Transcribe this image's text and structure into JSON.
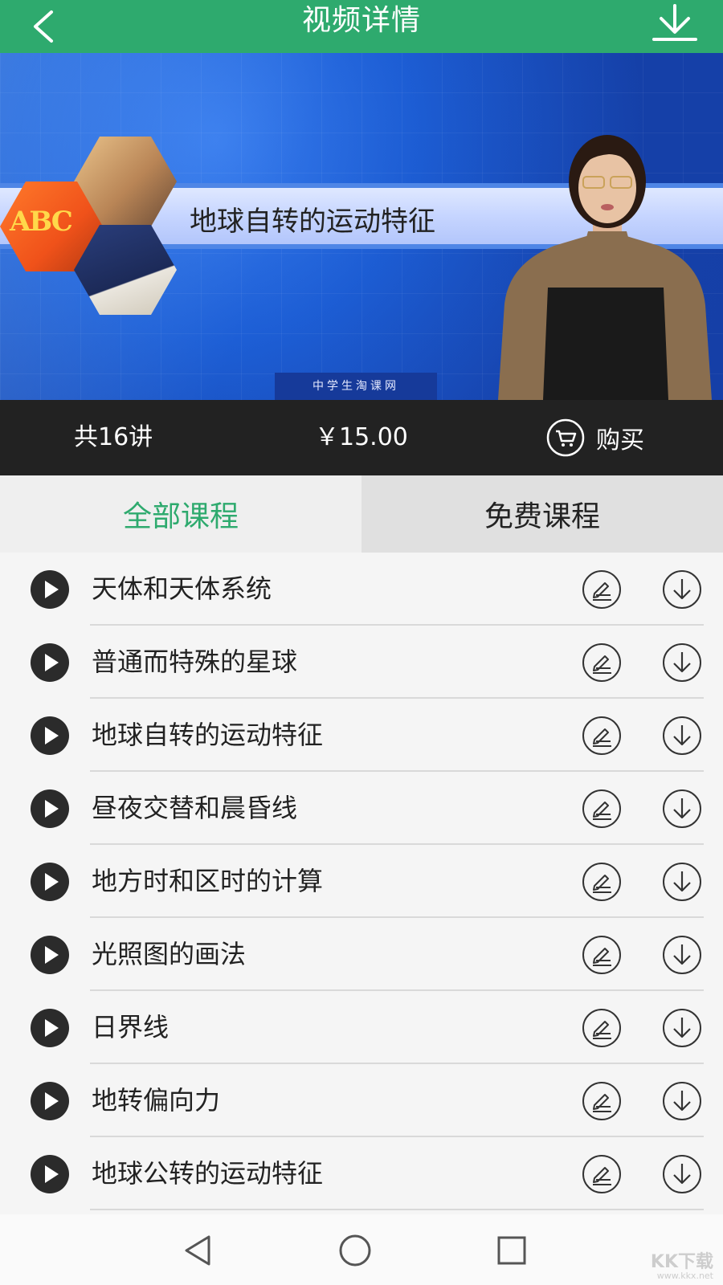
{
  "header": {
    "title": "视频详情",
    "back_icon": "chevron-left-icon",
    "download_icon": "download-icon",
    "background": "#2eaa6e"
  },
  "video": {
    "lesson_title": "地球自转的运动特征",
    "provider_caption": "中学生淘课网",
    "abc_text": "ABC"
  },
  "info_bar": {
    "lecture_count": "共16讲",
    "price": "￥15.00",
    "buy_label": "购买",
    "buy_icon": "cart-icon"
  },
  "tabs": [
    {
      "label": "全部课程",
      "active": true
    },
    {
      "label": "免费课程",
      "active": false
    }
  ],
  "lessons": [
    {
      "title": "天体和天体系统"
    },
    {
      "title": "普通而特殊的星球"
    },
    {
      "title": "地球自转的运动特征"
    },
    {
      "title": "昼夜交替和晨昏线"
    },
    {
      "title": "地方时和区时的计算"
    },
    {
      "title": "光照图的画法"
    },
    {
      "title": "日界线"
    },
    {
      "title": "地转偏向力"
    },
    {
      "title": "地球公转的运动特征"
    }
  ],
  "row_icons": {
    "play": "play-icon",
    "note": "edit-note-icon",
    "download": "download-circle-icon"
  },
  "navbar": {
    "back": "nav-back-icon",
    "home": "nav-home-icon",
    "recent": "nav-recent-icon"
  },
  "watermark": {
    "brand": "KK下载",
    "url": "www.kkx.net"
  },
  "colors": {
    "accent": "#2eaa6e",
    "info_bar": "#222222"
  }
}
